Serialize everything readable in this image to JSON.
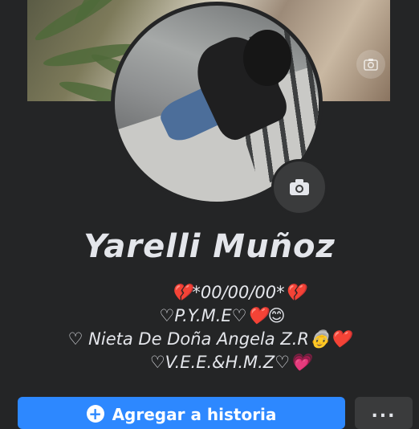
{
  "profile": {
    "name": "Yarelli Muñoz"
  },
  "bio": {
    "line1": "💔*00/00/00*💔",
    "line2": "♡P.Y.M.E♡❤️😊",
    "line3": "♡  Nieta De Doña Angela Z.R👵❤️",
    "line4": "♡V.E.E.&H.M.Z♡💗"
  },
  "actions": {
    "add_story_label": "Agregar a historia",
    "more_label": "..."
  },
  "icons": {
    "cover_camera": "camera-icon",
    "avatar_camera": "camera-icon",
    "plus": "plus-circle-icon"
  },
  "colors": {
    "background": "#242526",
    "accent": "#2d88ff",
    "secondary_button": "#3a3b3c"
  }
}
